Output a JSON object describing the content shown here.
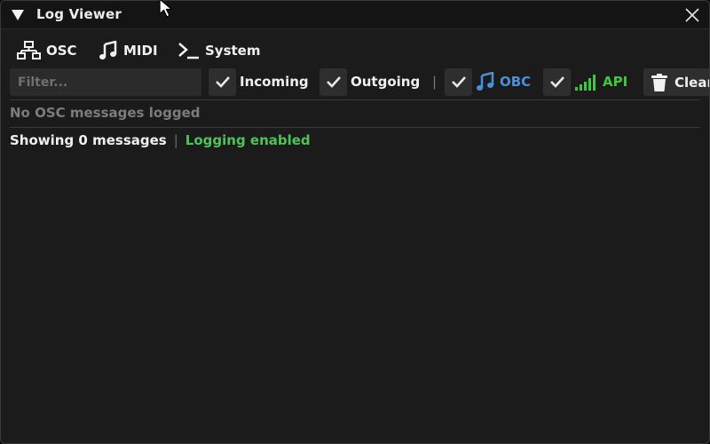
{
  "window": {
    "title": "Log Viewer"
  },
  "tabs": [
    {
      "label": "OSC",
      "icon": "network-icon"
    },
    {
      "label": "MIDI",
      "icon": "music-note-icon"
    },
    {
      "label": "System",
      "icon": "terminal-icon"
    }
  ],
  "filter": {
    "placeholder": "Filter...",
    "value": ""
  },
  "toggles": [
    {
      "label": "Incoming",
      "checked": true
    },
    {
      "label": "Outgoing",
      "checked": true
    },
    {
      "label": "OBC",
      "checked": true,
      "icon": "music-note-icon",
      "color": "#4a90d9"
    },
    {
      "label": "API",
      "checked": true,
      "icon": "signal-bars-icon",
      "color": "#3ec93a"
    }
  ],
  "separator": "|",
  "clear_button": {
    "label": "Clear",
    "icon": "trash-icon"
  },
  "empty_message": "No OSC messages logged",
  "status": {
    "count_text": "Showing 0 messages",
    "separator": "|",
    "logging_text": "Logging enabled",
    "logging_color": "#4cc456"
  }
}
